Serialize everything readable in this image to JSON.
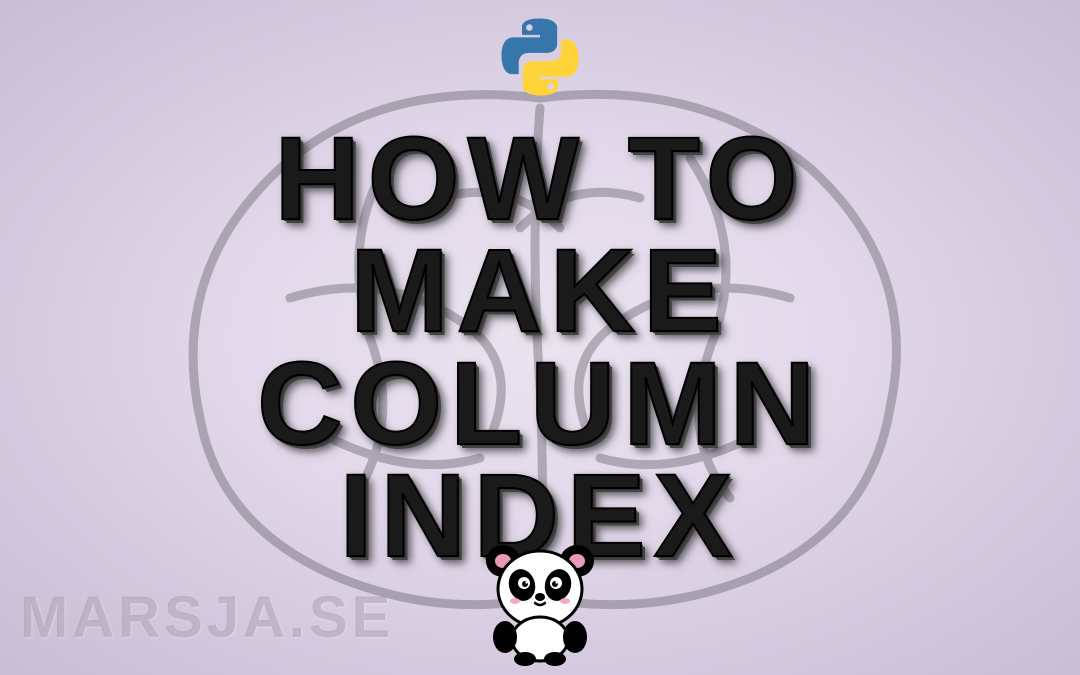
{
  "title": {
    "line1": "HOW TO",
    "line2": "MAKE",
    "line3": "COLUMN",
    "line4": "INDEX"
  },
  "watermark": "MARSJA.SE",
  "icons": {
    "top": "python-logo",
    "bottom": "panda-mascot"
  }
}
